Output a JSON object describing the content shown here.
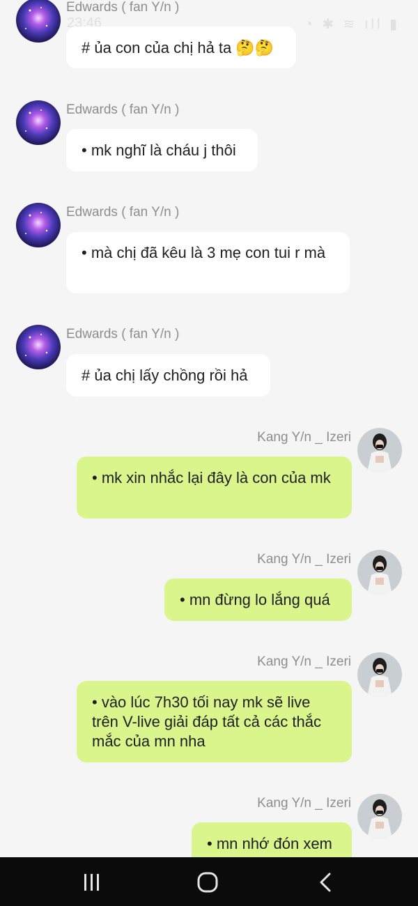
{
  "status_bar": {
    "time": "23:46",
    "icons_text": "◔ ✱ ≋ ıll ▮"
  },
  "messages": [
    {
      "sender": "Edwards ( fan Y/n )",
      "text": "# ủa con của chị hả ta 🤔🤔",
      "side": "in"
    },
    {
      "sender": "Edwards ( fan Y/n )",
      "text": "• mk nghĩ là cháu j thôi",
      "side": "in"
    },
    {
      "sender": "Edwards ( fan Y/n )",
      "text": "• mà chị đã kêu là 3 mẹ con tui r mà",
      "side": "in"
    },
    {
      "sender": "Edwards ( fan Y/n )",
      "text": "# ủa chị lấy chồng rồi hả",
      "side": "in"
    },
    {
      "sender": "Kang Y/n _ Izeri",
      "text": "• mk xin nhắc lại đây là con của mk",
      "side": "out"
    },
    {
      "sender": "Kang Y/n _ Izeri",
      "text": "• mn đừng lo lắng quá",
      "side": "out"
    },
    {
      "sender": "Kang Y/n _ Izeri",
      "text": "• vào lúc 7h30 tối nay mk sẽ live trên V-live giải đáp tất cả các thắc mắc của mn nha",
      "side": "out"
    },
    {
      "sender": "Kang Y/n _ Izeri",
      "text": "• mn nhớ đón xem",
      "side": "out"
    }
  ],
  "colors": {
    "incoming_bubble": "#ffffff",
    "outgoing_bubble": "#d9f58b",
    "background": "#f5f5f5",
    "nav_bar": "#0b0b0b"
  },
  "nav": {
    "icons": [
      "recent-apps-icon",
      "home-icon",
      "back-icon"
    ]
  }
}
